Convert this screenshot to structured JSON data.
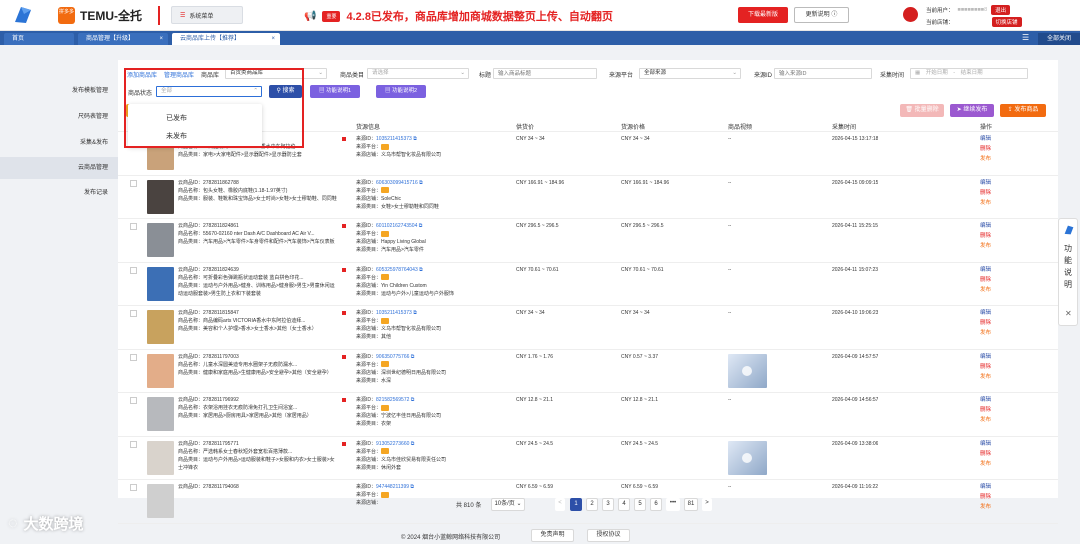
{
  "header": {
    "brand_badge": "拼多多",
    "brand": "TEMU-全托",
    "system_menu": "系统菜单",
    "announce_badge": "重要",
    "announce": "4.2.8已发布，商品库增加商城数据整页上传、自动翻页",
    "download_btn": "下载最新版",
    "update_btn": "更新说明",
    "user_label": "当前用户：",
    "user_value": "■■■■■■■■8",
    "logout": "退出",
    "store_label": "当前店铺：",
    "store_btn": "切换店铺"
  },
  "tabs": [
    {
      "label": "首页"
    },
    {
      "label": "商品管理【升级】"
    },
    {
      "label": "云商品库上传【推荐】"
    }
  ],
  "close_all": "全部关闭",
  "sidebar": {
    "items": [
      {
        "label": "发布模板管理"
      },
      {
        "label": "尺码表管理"
      },
      {
        "label": "采集&发布"
      },
      {
        "label": "云商品管理"
      },
      {
        "label": "发布记录"
      }
    ]
  },
  "filters": {
    "add_product": "添加商品库",
    "manage_library": "管理商品库",
    "library_label": "商品库",
    "library_value": "百货类商品库",
    "category_label": "商品类目",
    "category_placeholder": "请选择",
    "title_label": "标题",
    "title_placeholder": "输入商品标题",
    "platform_label": "来源平台",
    "platform_value": "全部来源",
    "source_id_label": "来源ID",
    "source_id_placeholder": "输入来源ID",
    "time_label": "采集时间",
    "start_placeholder": "开始日期",
    "range_sep": "-",
    "end_placeholder": "结束日期",
    "status_label": "商品状态",
    "status_value": "全部",
    "search_btn": "搜索",
    "fn_btn1": "功能说明1",
    "fn_btn2": "功能说明2",
    "status_options": [
      "已发布",
      "未发布"
    ],
    "collect_btn": "采集"
  },
  "toolbar": {
    "batch_delete": "批量删除",
    "continue_publish": "继续发布",
    "publish": "发布商品"
  },
  "table": {
    "headers": [
      "商品",
      "货源信息",
      "供货价",
      "货源价格",
      "商品视频",
      "采集时间",
      "操作"
    ],
    "rows": [
      {
        "id": "云商品ID：2782811869521",
        "name": "商品名称：11商品编码ArtsVICTORIA香水中东阿拉伯...",
        "cat": "商品类目：家电>大家电配件>显示器配件>显示器防尘套",
        "src_id": "1035211415373",
        "src_shop": "义乌市帮智化妆品有限公司",
        "src_cat": "",
        "price1": "CNY 34 ~ 34",
        "price2": "CNY 34 ~ 34",
        "video": "--",
        "time": "2026-04-15 13:17:18",
        "flag": true,
        "color": "#c9a27a"
      },
      {
        "id": "云商品ID：2782811862788",
        "name": "商品名称：包头女鞋、橡胶内底鞋(1.18-1.97英寸)",
        "cat": "商品类目：服装、鞋靴和珠宝饰品>女士时尚>女鞋>女士穆勒鞋、同同鞋",
        "src_id": "606303099415716",
        "src_shop": "SoleChic",
        "src_cat": "来源类目：女鞋>女士穆勒鞋和同同鞋",
        "price1": "CNY 166.91 ~ 184.96",
        "price2": "CNY 166.91 ~ 184.96",
        "video": "--",
        "time": "2026-04-15 09:09:15",
        "flag": false,
        "color": "#4a4340"
      },
      {
        "id": "云商品ID：2782811824861",
        "name": "商品名称：55670-02160 nter Dash A/C Dashboard AC Air V...",
        "cat": "商品类目：汽车用品>汽车零件>车身零件和配件>汽车装饰>汽车仪表板",
        "src_id": "601102162743504",
        "src_shop": "Happy Living Global",
        "src_cat": "来源类目：汽车用品>汽车零件",
        "price1": "CNY 296.5 ~ 296.5",
        "price2": "CNY 296.5 ~ 296.5",
        "video": "--",
        "time": "2026-04-11 15:25:15",
        "flag": true,
        "color": "#8a8f96"
      },
      {
        "id": "云商品ID：2782811824639",
        "name": "商品名称：可折叠彩色弹跳瓶状运动套装 蓝白拼色印花...",
        "cat": "商品类目：运动与户外用品>健身、训练用品>健身服>男生>男童休闲运动运动服套装>男生防上衣和下装套装",
        "src_id": "605325978764043",
        "src_shop": "Yin Children Custom",
        "src_cat": "来源类目：运动与户外>儿童运动与户外服饰",
        "price1": "CNY 70.61 ~ 70.61",
        "price2": "CNY 70.61 ~ 70.61",
        "video": "--",
        "time": "2026-04-11 15:07:23",
        "flag": true,
        "color": "#3c6fb5"
      },
      {
        "id": "云商品ID：2782811815847",
        "name": "商品名称：商品编码arts VICTORIA香水中东阿拉伯迪拜...",
        "cat": "商品类目：美容和个人护理>香水>女士香水>其他（女士香水）",
        "src_id": "1035211415373",
        "src_shop": "义乌市帮智化妆品有限公司",
        "src_cat": "来源类目：其他",
        "price1": "CNY 34 ~ 34",
        "price2": "CNY 34 ~ 34",
        "video": "--",
        "time": "2026-04-10 19:06:23",
        "flag": true,
        "color": "#c8a25e"
      },
      {
        "id": "云商品ID：2782811797003",
        "name": "商品名称：儿童水深圆美迪专用水圈架子无痕防漏水...",
        "cat": "商品类目：健康和家庭用品>生健康用品>安全避孕>其他（安全避孕）",
        "src_id": "906350775766",
        "src_shop": "深圳世纪德明日用品有限公司",
        "src_cat": "来源类目：水深",
        "price1": "CNY 1.76 ~ 1.76",
        "price2": "CNY 0.57 ~ 3.37",
        "video": "video",
        "time": "2026-04-09 14:57:57",
        "flag": true,
        "color": "#e3ad89"
      },
      {
        "id": "云商品ID：2782811796992",
        "name": "商品名称：衣架浴用挂衣无痕防滑免打孔卫生间浴室...",
        "cat": "商品类目：家居用品>厨房用具>家居用品>其他（家居用品）",
        "src_id": "821582569572",
        "src_shop": "宁波亿丰佳日用品有限公司",
        "src_cat": "来源类目：衣架",
        "price1": "CNY 12.8 ~ 21.1",
        "price2": "CNY 12.8 ~ 21.1",
        "video": "--",
        "time": "2026-04-09 14:56:57",
        "flag": true,
        "color": "#b7b9bd"
      },
      {
        "id": "云商品ID：2782811795771",
        "name": "商品名称：严选韩系女士春秋短外套宽松百搭薄款...",
        "cat": "商品类目：运动与户外用品>运动服装和鞋子>女服和内衣>女士服装>女士冲锋衣",
        "src_id": "913052273660",
        "src_shop": "义乌市佳欣贸易有限责任公司",
        "src_cat": "来源类目：休闲外套",
        "price1": "CNY 24.5 ~ 24.5",
        "price2": "CNY 24.5 ~ 24.5",
        "video": "video",
        "time": "2026-04-09 13:38:06",
        "flag": true,
        "color": "#d9d3cc"
      },
      {
        "id": "云商品ID：2782811794068",
        "name": "",
        "cat": "",
        "src_id": "947448211399",
        "src_shop": "",
        "src_cat": "",
        "price1": "CNY 6.59 ~ 6.59",
        "price2": "CNY 6.59 ~ 6.59",
        "video": "--",
        "time": "2026-04-09 11:16:22",
        "flag": false,
        "color": "#cfcfcf"
      }
    ],
    "src_id_label": "来源ID：",
    "src_platform_label": "来源平台：",
    "src_shop_label": "来源店铺：",
    "actions": [
      "编辑",
      "删除",
      "发布"
    ]
  },
  "pager": {
    "total": "共 810 条",
    "page_size": "10条/页",
    "pages": [
      "1",
      "2",
      "3",
      "4",
      "5",
      "6",
      "•••",
      "81"
    ],
    "prev": "<",
    "next": ">"
  },
  "footer": {
    "copyright": "© 2024 烟台小蓝鲸网络科技有限公司",
    "disclaimer": "免责声明",
    "license": "授权协议"
  },
  "float_help": {
    "text": "功能说明",
    "close": "✕"
  },
  "watermark": "大数跨境"
}
